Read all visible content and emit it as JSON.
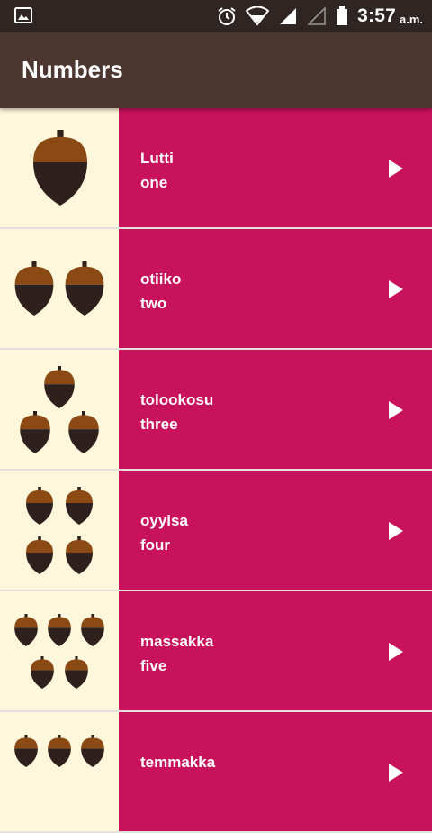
{
  "status_bar": {
    "time": "3:57",
    "ampm": "a.m.",
    "icons": [
      "gallery-icon",
      "alarm-icon",
      "wifi-icon",
      "signal-icon",
      "signal-empty-icon",
      "battery-icon"
    ]
  },
  "app_bar": {
    "title": "Numbers"
  },
  "colors": {
    "status_bar": "#2f2624",
    "app_bar": "#4b3630",
    "item_background": "#c8125c",
    "image_background": "#fff7dc",
    "acorn_cap": "#8b4a13",
    "acorn_body": "#2e201c"
  },
  "items": [
    {
      "miwok": "Lutti",
      "english": "one",
      "acorn_count": 1
    },
    {
      "miwok": "otiiko",
      "english": "two",
      "acorn_count": 2
    },
    {
      "miwok": "tolookosu",
      "english": "three",
      "acorn_count": 3
    },
    {
      "miwok": "oyyisa",
      "english": "four",
      "acorn_count": 4
    },
    {
      "miwok": "massakka",
      "english": "five",
      "acorn_count": 5
    },
    {
      "miwok": "temmakka",
      "english": "",
      "acorn_count": 6
    }
  ]
}
